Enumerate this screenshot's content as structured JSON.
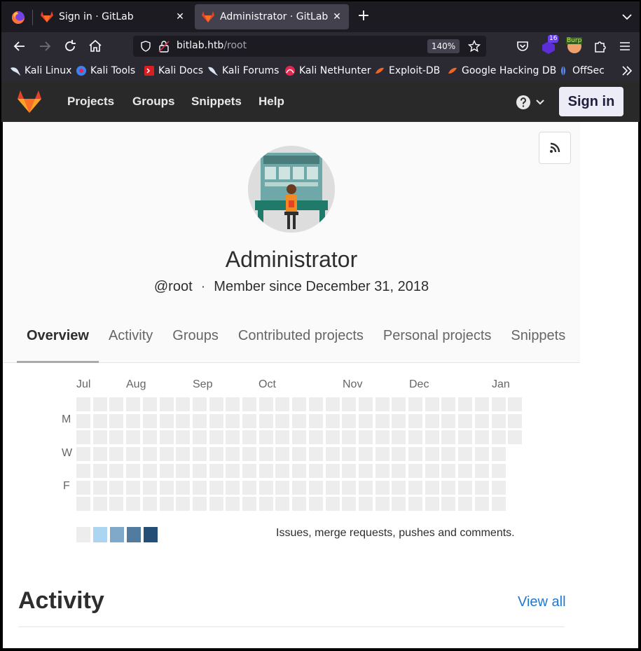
{
  "browser": {
    "tabs": [
      {
        "title": "Sign in · GitLab",
        "active": false
      },
      {
        "title": "Administrator · GitLab",
        "active": true
      }
    ],
    "url_host": "bitlab.htb",
    "url_path": "/root",
    "zoom": "140%",
    "ext_badge": "16",
    "ext_label": "Burp",
    "bookmarks": [
      "Kali Linux",
      "Kali Tools",
      "Kali Docs",
      "Kali Forums",
      "Kali NetHunter",
      "Exploit-DB",
      "Google Hacking DB",
      "OffSec"
    ]
  },
  "gitlab": {
    "nav": [
      "Projects",
      "Groups",
      "Snippets",
      "Help"
    ],
    "sign_in": "Sign in",
    "help_icon": "?"
  },
  "profile": {
    "name": "Administrator",
    "username": "@root",
    "member_since": "Member since December 31, 2018",
    "tabs": [
      "Overview",
      "Activity",
      "Groups",
      "Contributed projects",
      "Personal projects",
      "Snippets"
    ],
    "active_tab": "Overview"
  },
  "calendar": {
    "months": [
      "Jul",
      "Aug",
      "Sep",
      "Oct",
      "Nov",
      "Dec",
      "Jan"
    ],
    "day_labels": [
      "M",
      "W",
      "F"
    ],
    "legend_text": "Issues, merge requests, pushes and comments.",
    "legend_colors": [
      "#ededed",
      "#acd5f2",
      "#7fa8c9",
      "#527ba0",
      "#254e77"
    ],
    "cell_color": "#ededed"
  },
  "activity": {
    "title": "Activity",
    "view_all": "View all"
  },
  "colors": {
    "header_bg": "#292929",
    "link": "#1f78d1"
  }
}
